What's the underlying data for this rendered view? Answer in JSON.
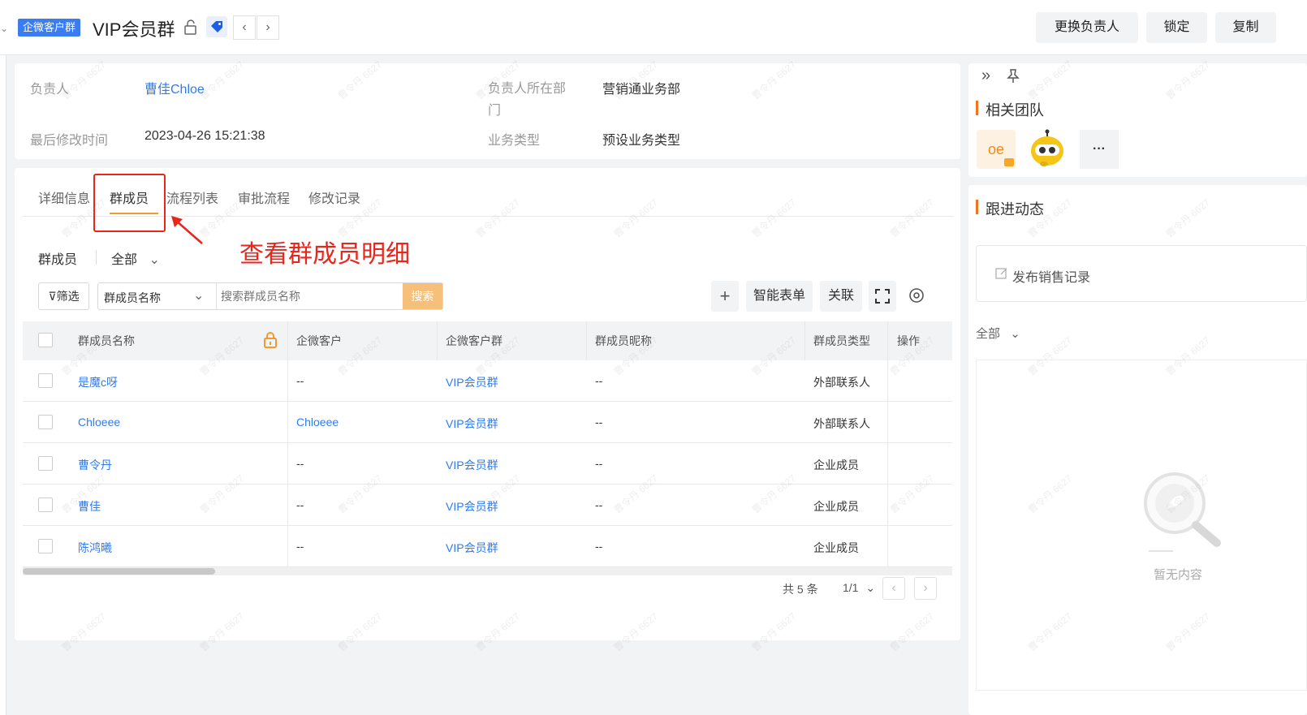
{
  "header": {
    "badge": "企微客户群",
    "title": "VIP会员群",
    "prev": "‹",
    "next": "›",
    "buttons": [
      "更换负责人",
      "锁定",
      "复制"
    ]
  },
  "info": {
    "owner_label": "负责人",
    "owner_value": "曹佳Chloe",
    "dept_label": "负责人所在部门",
    "dept_value": "营销通业务部",
    "modified_label": "最后修改时间",
    "modified_value": "2023-04-26 15:21:38",
    "biztype_label": "业务类型",
    "biztype_value": "预设业务类型"
  },
  "tabs": [
    "详细信息",
    "群成员",
    "流程列表",
    "审批流程",
    "修改记录"
  ],
  "annotation": "查看群成员明细",
  "filter_bar": {
    "section_label": "群成员",
    "scope_value": "全部",
    "filter_label": "筛选",
    "field_select": "群成员名称",
    "search_placeholder": "搜索群成员名称",
    "search_button": "搜索",
    "add_label": "+",
    "smart_form": "智能表单",
    "relate": "关联"
  },
  "table": {
    "columns": [
      "群成员名称",
      "企微客户",
      "企微客户群",
      "群成员昵称",
      "群成员类型",
      "操作"
    ],
    "rows": [
      {
        "name": "是魔c呀",
        "customer": "--",
        "group": "VIP会员群",
        "nickname": "--",
        "type": "外部联系人"
      },
      {
        "name": "Chloeee",
        "customer": "Chloeee",
        "group": "VIP会员群",
        "nickname": "--",
        "type": "外部联系人"
      },
      {
        "name": "曹令丹",
        "customer": "--",
        "group": "VIP会员群",
        "nickname": "--",
        "type": "企业成员"
      },
      {
        "name": "曹佳",
        "customer": "--",
        "group": "VIP会员群",
        "nickname": "--",
        "type": "企业成员"
      },
      {
        "name": "陈鸿曦",
        "customer": "--",
        "group": "VIP会员群",
        "nickname": "--",
        "type": "企业成员"
      }
    ]
  },
  "pager": {
    "total": "共 5 条",
    "page": "1/1"
  },
  "right_panel": {
    "team_title": "相关团队",
    "team_avatar_text": "oe",
    "more": "···",
    "follow_title": "跟进动态",
    "publish": "发布销售记录",
    "scope": "全部",
    "empty": "暂无内容"
  },
  "watermark": "曹令丹 6627",
  "colors": {
    "accent": "#2f7bf0",
    "orange": "#f39a2c",
    "annotation": "#e8261c"
  }
}
